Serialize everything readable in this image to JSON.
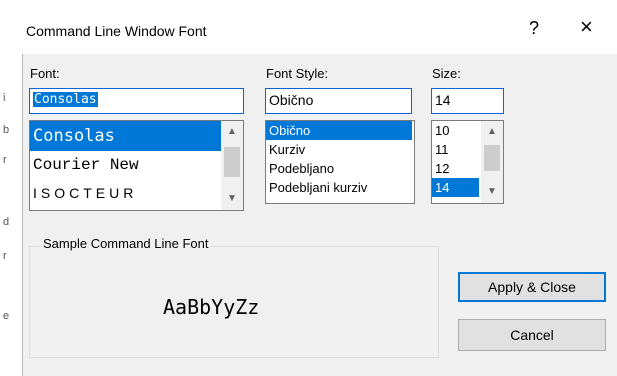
{
  "dialog": {
    "title": "Command Line Window Font"
  },
  "titlebar": {
    "help_glyph": "?",
    "close_glyph": "×"
  },
  "font": {
    "label": "Font:",
    "value": "Consolas",
    "items": [
      "Consolas",
      "Courier New",
      "ISOCTEUR"
    ],
    "selected_index": 0
  },
  "style": {
    "label": "Font Style:",
    "value": "Obično",
    "items": [
      "Obično",
      "Kurziv",
      "Podebljano",
      "Podebljani kurziv"
    ],
    "selected_index": 0
  },
  "size": {
    "label": "Size:",
    "value": "14",
    "items": [
      "10",
      "11",
      "12",
      "14"
    ],
    "selected_index": 3
  },
  "sample": {
    "label": "Sample Command Line Font",
    "text": "AaBbYyZz"
  },
  "buttons": {
    "apply_close": "Apply & Close",
    "cancel": "Cancel"
  },
  "left_strip": [
    "i",
    "b",
    "r",
    "d",
    "r",
    "e"
  ],
  "colors": {
    "selection": "#0078d7",
    "dialog_bg": "#f0f0f0"
  },
  "icons": {
    "scroll_up": "chevron-up-icon",
    "scroll_down": "chevron-down-icon"
  }
}
